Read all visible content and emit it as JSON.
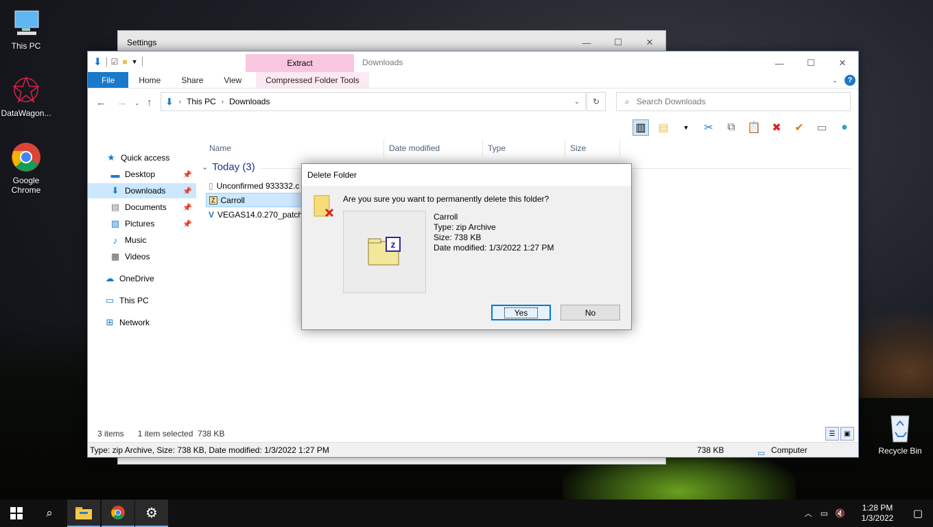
{
  "desktop": {
    "icons": [
      {
        "label": "This PC"
      },
      {
        "label": "DataWagon..."
      },
      {
        "label": "Google Chrome"
      },
      {
        "label": "Recycle Bin"
      }
    ]
  },
  "settings_window": {
    "title": "Settings"
  },
  "explorer": {
    "context_tab": "Extract",
    "window_title": "Downloads",
    "ribbon_tabs": [
      "File",
      "Home",
      "Share",
      "View",
      "Compressed Folder Tools"
    ],
    "breadcrumb": [
      "This PC",
      "Downloads"
    ],
    "search_placeholder": "Search Downloads",
    "nav": {
      "quick_access": "Quick access",
      "items": [
        "Desktop",
        "Downloads",
        "Documents",
        "Pictures",
        "Music",
        "Videos"
      ],
      "onedrive": "OneDrive",
      "this_pc": "This PC",
      "network": "Network"
    },
    "columns": [
      "Name",
      "Date modified",
      "Type",
      "Size"
    ],
    "group": "Today (3)",
    "files": [
      "Unconfirmed 933332.c",
      "Carroll",
      "VEGAS14.0.270_patch_"
    ],
    "status": {
      "items": "3 items",
      "selected": "1 item selected",
      "size": "738 KB"
    },
    "bottom": {
      "details": "Type: zip Archive, Size: 738 KB, Date modified: 1/3/2022 1:27 PM",
      "size": "738 KB",
      "location": "Computer"
    }
  },
  "dialog": {
    "title": "Delete Folder",
    "message": "Are you sure you want to permanently delete this folder?",
    "item_name": "Carroll",
    "item_type": "Type: zip Archive",
    "item_size": "Size: 738 KB",
    "item_date": "Date modified: 1/3/2022 1:27 PM",
    "yes": "Yes",
    "no": "No"
  },
  "taskbar": {
    "time": "1:28 PM",
    "date": "1/3/2022"
  }
}
